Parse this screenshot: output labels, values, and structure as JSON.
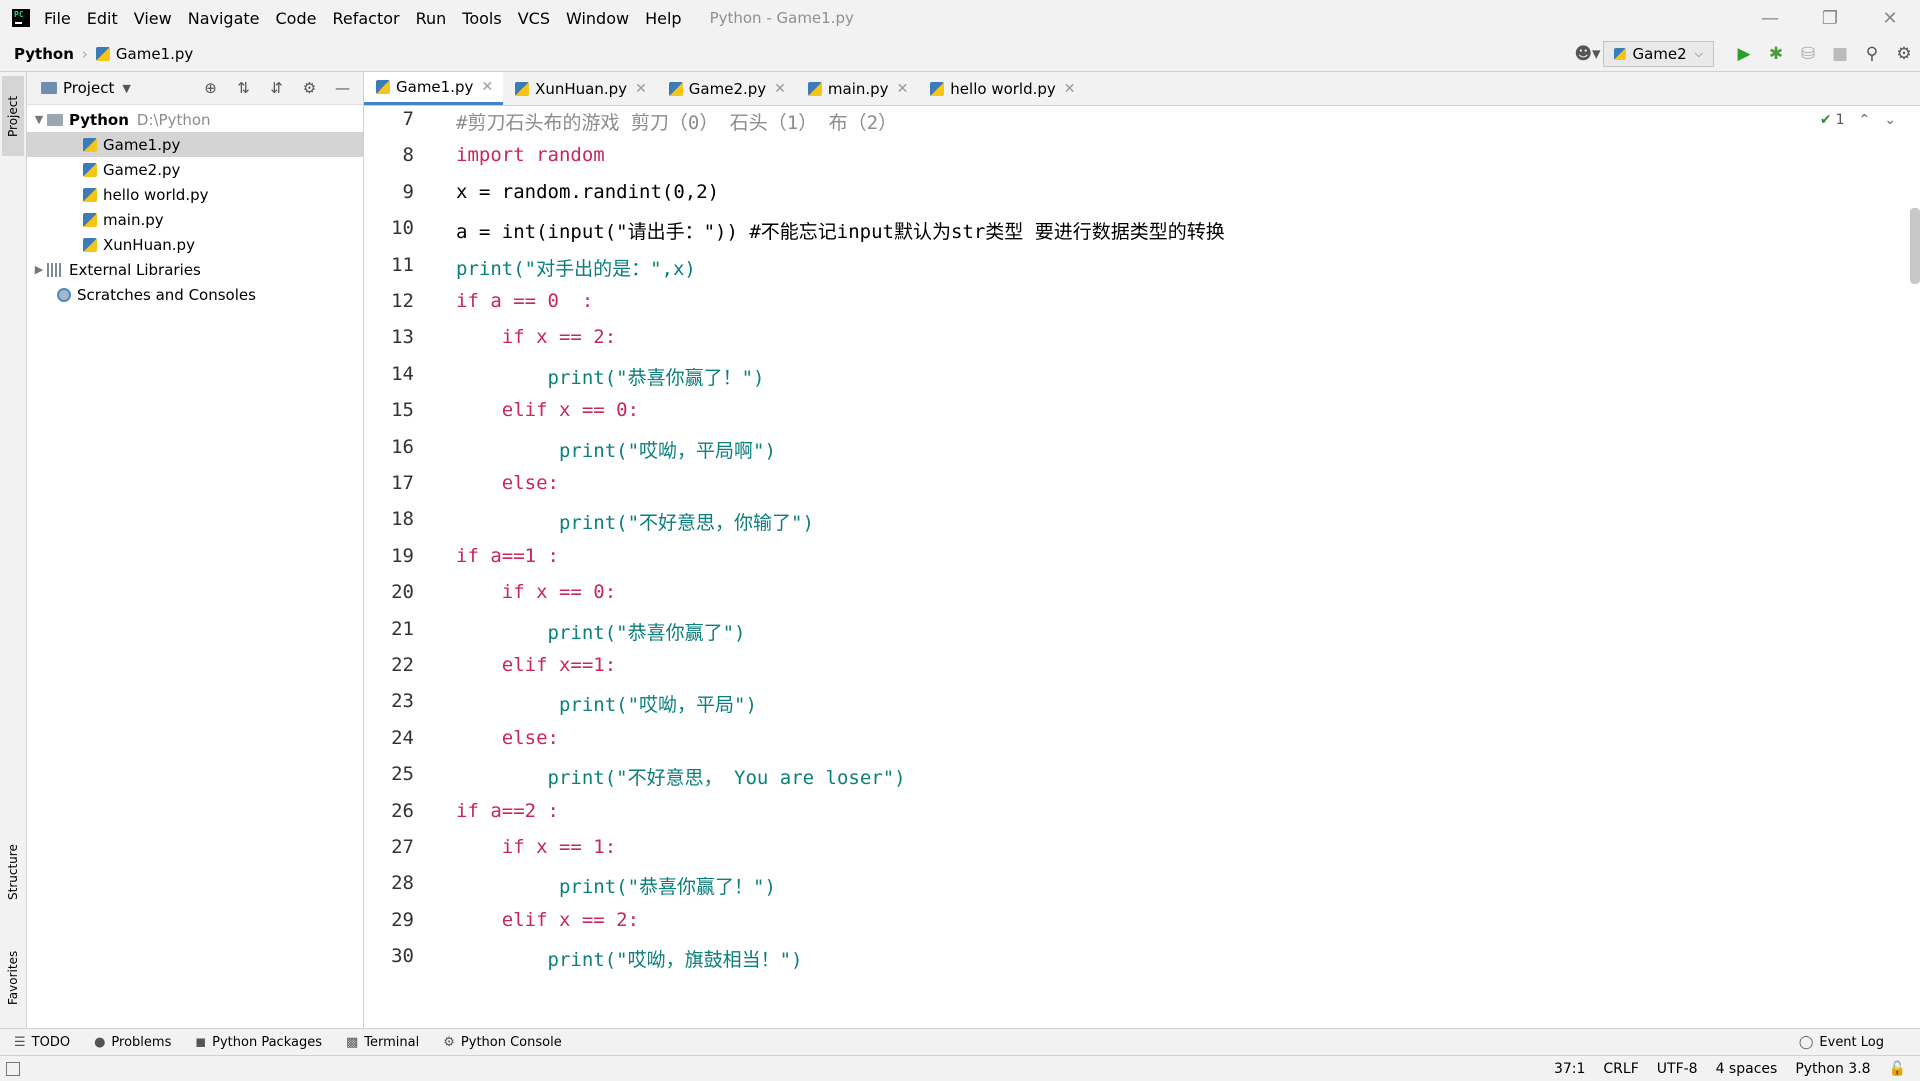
{
  "menu": {
    "items": [
      {
        "label": "File"
      },
      {
        "label": "Edit"
      },
      {
        "label": "View"
      },
      {
        "label": "Navigate"
      },
      {
        "label": "Code"
      },
      {
        "label": "Refactor"
      },
      {
        "label": "Run"
      },
      {
        "label": "Tools"
      },
      {
        "label": "VCS"
      },
      {
        "label": "Window"
      },
      {
        "label": "Help"
      }
    ],
    "window_title": "Python - Game1.py"
  },
  "navbar": {
    "project": "Python",
    "file": "Game1.py",
    "run_config": "Game2"
  },
  "project_panel": {
    "title": "Project",
    "root_name": "Python",
    "root_path": "D:\\Python",
    "files": [
      "Game1.py",
      "Game2.py",
      "hello world.py",
      "main.py",
      "XunHuan.py"
    ],
    "external_libraries": "External Libraries",
    "scratches": "Scratches and Consoles",
    "side_tabs": {
      "project": "Project",
      "structure": "Structure",
      "favorites": "Favorites"
    }
  },
  "tabs": [
    {
      "label": "Game1.py",
      "active": true
    },
    {
      "label": "XunHuan.py",
      "active": false
    },
    {
      "label": "Game2.py",
      "active": false
    },
    {
      "label": "main.py",
      "active": false
    },
    {
      "label": "hello world.py",
      "active": false
    }
  ],
  "editor": {
    "inspection_count": "1",
    "line_numbers": [
      "7",
      "8",
      "9",
      "10",
      "11",
      "12",
      "13",
      "14",
      "15",
      "16",
      "17",
      "18",
      "19",
      "20",
      "21",
      "22",
      "23",
      "24",
      "25",
      "26",
      "27",
      "28",
      "29",
      "30"
    ],
    "lines": [
      "#剪刀石头布的游戏 剪刀（0） 石头（1） 布（2）",
      "import random",
      "x = random.randint(0,2)",
      "a = int(input(\"请出手：\")) #不能忘记input默认为str类型 要进行数据类型的转换",
      "print(\"对手出的是：\",x)",
      "if a == 0  :",
      "    if x == 2:",
      "        print(\"恭喜你赢了！\")",
      "    elif x == 0:",
      "         print(\"哎呦，平局啊\")",
      "    else:",
      "         print(\"不好意思，你输了\")",
      "if a==1 :",
      "    if x == 0:",
      "        print(\"恭喜你赢了\")",
      "    elif x==1:",
      "         print(\"哎呦，平局\")",
      "    else:",
      "        print(\"不好意思， You are loser\")",
      "if a==2 :",
      "    if x == 1:",
      "         print(\"恭喜你赢了！\")",
      "    elif x == 2:",
      "        print(\"哎呦，旗鼓相当！\")"
    ]
  },
  "bottom_tabs": {
    "todo": "TODO",
    "problems": "Problems",
    "packages": "Python Packages",
    "terminal": "Terminal",
    "console": "Python Console",
    "event_log": "Event Log"
  },
  "status": {
    "position": "37:1",
    "line_sep": "CRLF",
    "encoding": "UTF-8",
    "indent": "4 spaces",
    "interpreter": "Python 3.8"
  },
  "colors": {
    "keyword": "#0033b3",
    "keyword_control": "#c9255e",
    "function": "#1a7ea8",
    "string": "#0b7f7b",
    "comment": "#8c8c8c",
    "run_green": "#2ca02c",
    "accent": "#4083c9"
  }
}
